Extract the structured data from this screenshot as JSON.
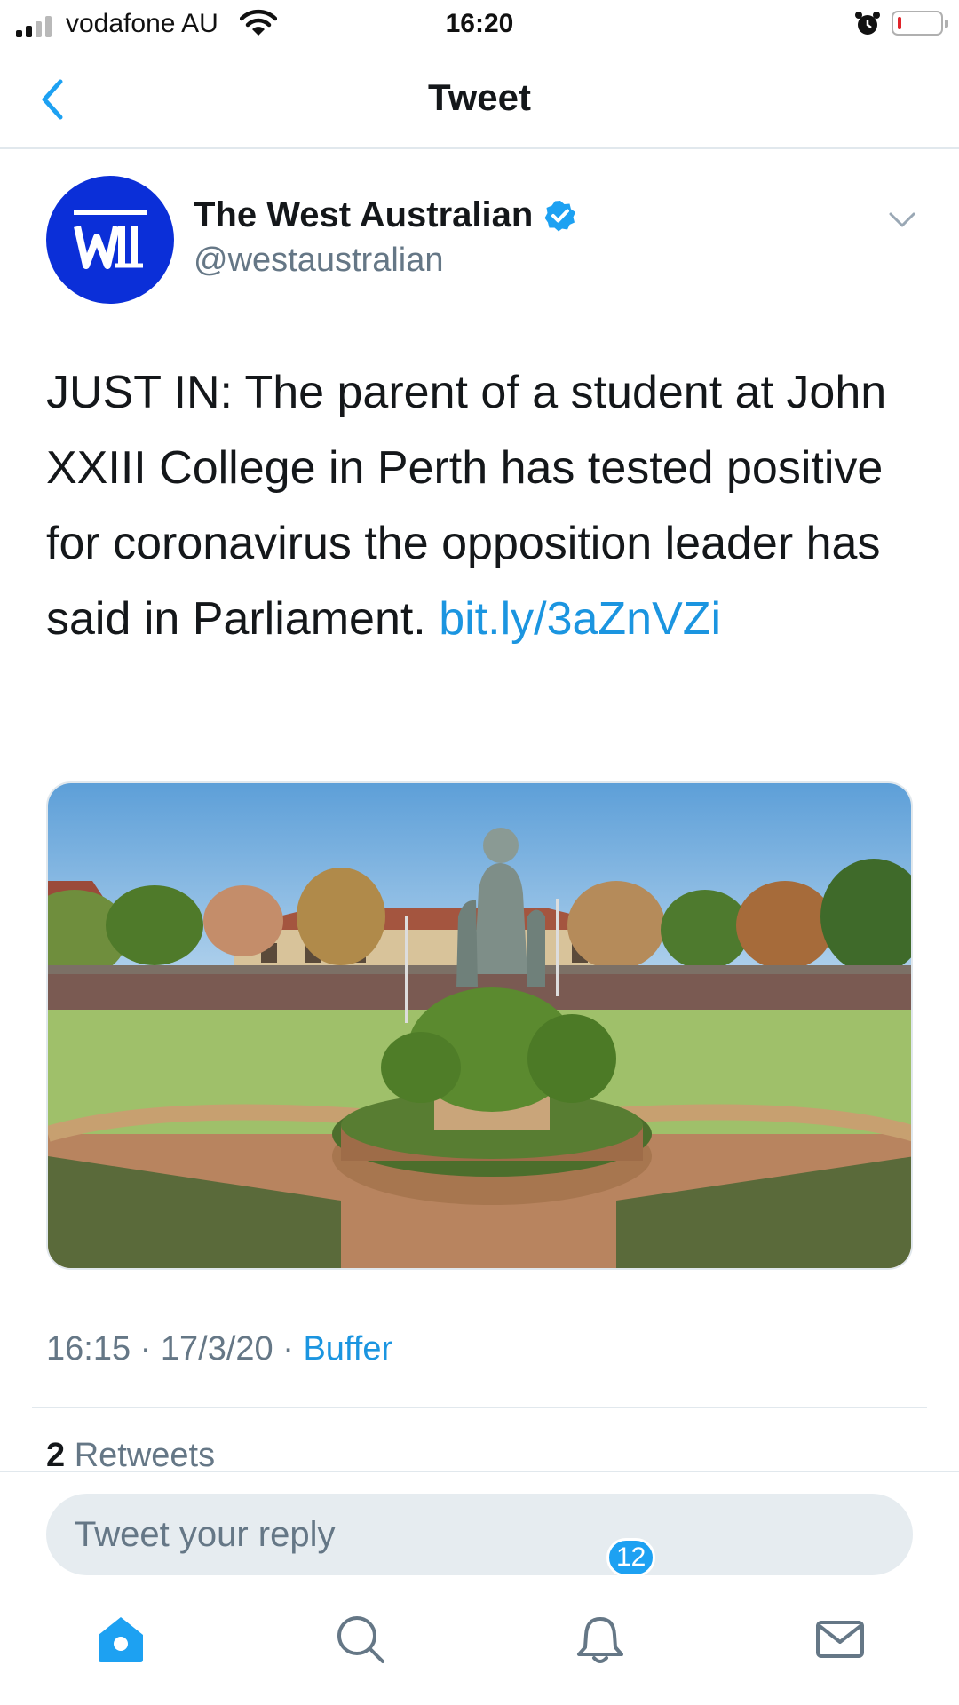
{
  "status_bar": {
    "carrier": "vodafone AU",
    "time": "16:20",
    "battery_level": 0.08,
    "icons": [
      "signal-icon",
      "wifi-icon",
      "alarm-icon",
      "battery-icon"
    ]
  },
  "header": {
    "title": "Tweet",
    "back_icon": "chevron-left-icon"
  },
  "tweet": {
    "author_name": "The West Australian",
    "verified": true,
    "handle": "@westaustralian",
    "text": "JUST IN: The parent of a student at John XXIII College in Perth has tested positive for coronavirus the opposition leader has said in Parliament. ",
    "link": "bit.ly/​3aZnVZi",
    "time": "16:15",
    "date": "17/3/20",
    "source": "Buffer",
    "retweet_count": "2",
    "retweet_label": "Retweets"
  },
  "reply": {
    "placeholder": "Tweet your reply"
  },
  "tab_bar": {
    "tabs": [
      "home-icon",
      "search-icon",
      "notifications-icon",
      "messages-icon"
    ],
    "notification_badge": "12"
  },
  "colors": {
    "accent": "#1da1f2",
    "link": "#1b95e0",
    "avatar_bg": "#0b2fd8",
    "muted": "#657786",
    "divider": "#e1e8ed"
  }
}
